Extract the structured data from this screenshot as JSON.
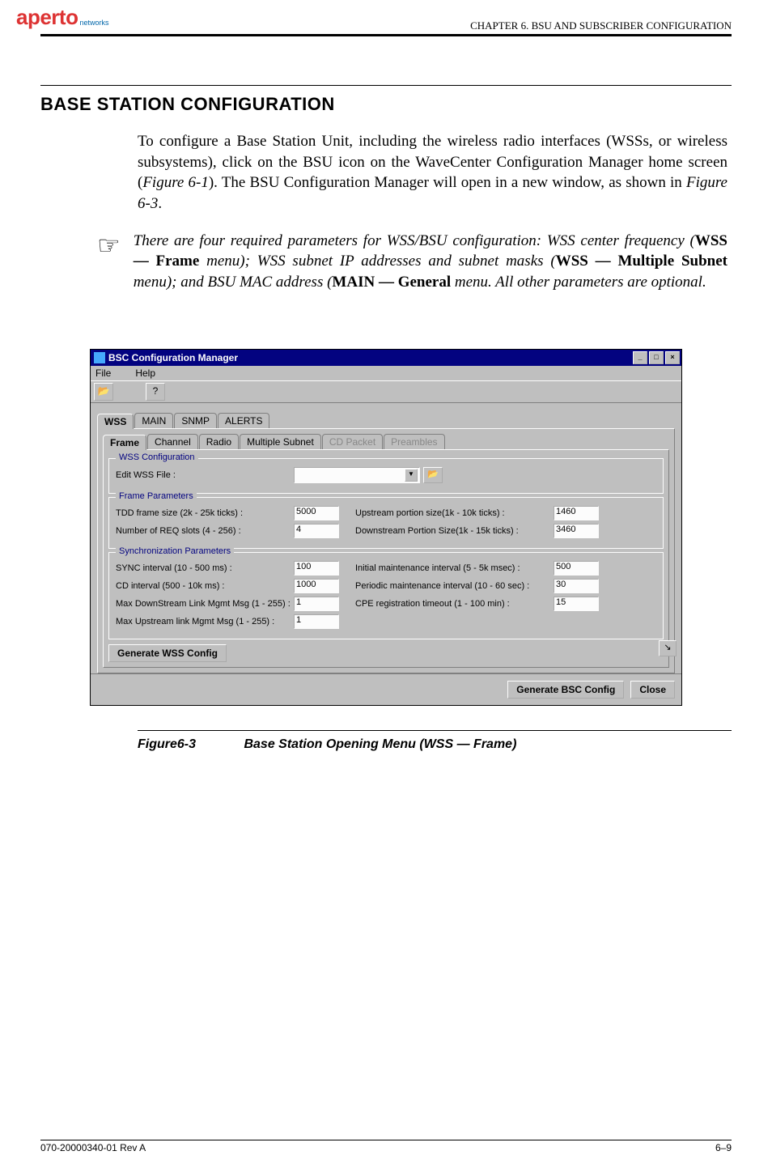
{
  "header": {
    "logo_brand": "aperto",
    "logo_sub": "networks",
    "chapter": "CHAPTER 6.   BSU AND SUBSCRIBER CONFIGURATION"
  },
  "section_title": "BASE STATION CONFIGURATION",
  "body_paragraph": "To configure a Base Station Unit, including the wireless radio interfaces (WSSs, or wireless subsystems), click on the BSU icon on the WaveCenter Configuration Manager home screen (",
  "body_ref1": "Figure 6-1",
  "body_mid": "). The BSU Configuration Manager will open in a new window, as shown in ",
  "body_ref2": "Figure 6-3",
  "body_end": ".",
  "note": {
    "p1": "There are four required parameters for WSS/BSU configuration: WSS center frequency (",
    "b1": "WSS — Frame",
    "p2": " menu); WSS subnet IP addresses and subnet masks (",
    "b2": "WSS — Multiple Subnet",
    "p3": " menu); and BSU MAC address (",
    "b3": "MAIN — General",
    "p4": " menu. All other parameters are optional."
  },
  "app": {
    "title": "BSC Configuration Manager",
    "menu_file": "File",
    "menu_help": "Help",
    "outer_tabs": [
      "WSS",
      "MAIN",
      "SNMP",
      "ALERTS"
    ],
    "inner_tabs": [
      "Frame",
      "Channel",
      "Radio",
      "Multiple Subnet",
      "CD Packet",
      "Preambles"
    ],
    "wss_config_title": "WSS Configuration",
    "edit_wss_file": "Edit WSS File :",
    "frame_params_title": "Frame Parameters",
    "tdd_label": "TDD frame size (2k - 25k ticks) :",
    "tdd_value": "5000",
    "upstream_label": "Upstream portion size(1k - 10k ticks) :",
    "upstream_value": "1460",
    "req_label": "Number of REQ slots (4 - 256) :",
    "req_value": "4",
    "downstream_label": "Downstream Portion Size(1k - 15k ticks) :",
    "downstream_value": "3460",
    "sync_params_title": "Synchronization Parameters",
    "sync_interval_label": "SYNC interval (10 - 500 ms) :",
    "sync_interval_value": "100",
    "init_maint_label": "Initial maintenance interval (5 - 5k msec) :",
    "init_maint_value": "500",
    "cd_interval_label": "CD interval (500 - 10k ms) :",
    "cd_interval_value": "1000",
    "periodic_maint_label": "Periodic maintenance interval (10 - 60 sec) :",
    "periodic_maint_value": "30",
    "max_down_label": "Max DownStream Link Mgmt Msg (1 - 255) :",
    "max_down_value": "1",
    "cpe_reg_label": "CPE registration timeout (1 - 100 min) :",
    "cpe_reg_value": "15",
    "max_up_label": "Max Upstream link Mgmt Msg (1 - 255) :",
    "max_up_value": "1",
    "gen_wss": "Generate WSS Config",
    "gen_bsc": "Generate BSC Config",
    "close": "Close"
  },
  "figure": {
    "num": "Figure6-3",
    "caption": "Base Station Opening Menu (WSS — Frame)"
  },
  "footer": {
    "left": "070-20000340-01 Rev A",
    "right": "6–9"
  }
}
